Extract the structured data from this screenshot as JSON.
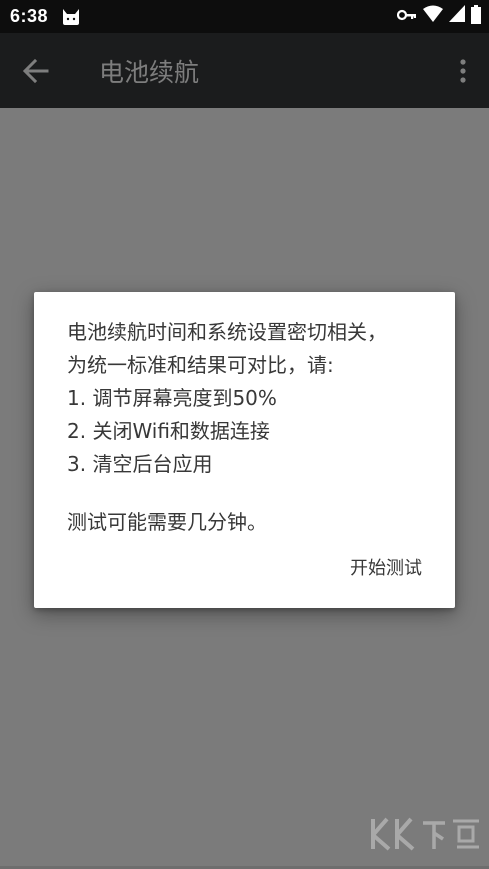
{
  "status_bar": {
    "time": "6:38",
    "left_icon": "cat-notification-icon",
    "right_icons": [
      "vpn-key-icon",
      "wifi-icon",
      "cellular-signal-icon",
      "battery-icon"
    ]
  },
  "app_bar": {
    "title": "电池续航",
    "back_icon": "arrow-back-icon",
    "menu_icon": "more-vertical-icon"
  },
  "dialog": {
    "lines": [
      "电池续航时间和系统设置密切相关，",
      "为统一标准和结果可对比，请:",
      "1. 调节屏幕亮度到50%",
      "2. 关闭Wifi和数据连接",
      "3. 清空后台应用"
    ],
    "note": "测试可能需要几分钟。",
    "action_label": "开始测试"
  },
  "colors": {
    "status_bar": "#0d0d0d",
    "app_bar": "#1b1c1d",
    "scrim": "#7b7b7b",
    "dialog_bg": "#ffffff",
    "dialog_text": "#383838"
  }
}
